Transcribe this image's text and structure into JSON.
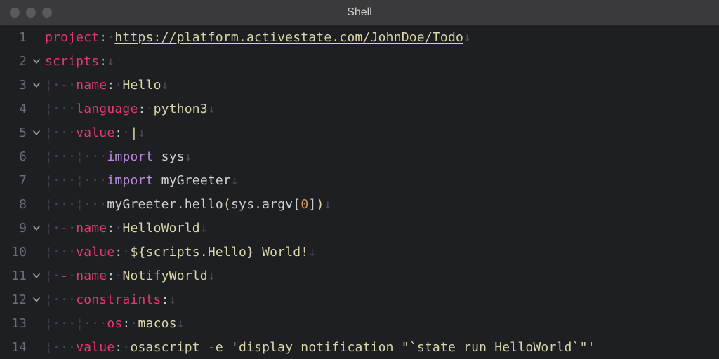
{
  "window": {
    "title": "Shell"
  },
  "glyphs": {
    "dot": "·",
    "nl": "↓",
    "guide": "¦"
  },
  "folds": {
    "2": true,
    "3": true,
    "5": true,
    "9": true,
    "11": true,
    "12": true
  },
  "code": {
    "line1": {
      "key": "project",
      "url": "https://platform.activestate.com/JohnDoe/Todo"
    },
    "line2": {
      "key": "scripts"
    },
    "line3": {
      "key": "name",
      "val": "Hello"
    },
    "line4": {
      "key": "language",
      "val": "python3"
    },
    "line5": {
      "key": "value",
      "pipe": "|"
    },
    "line6": {
      "kw": "import",
      "id": "sys"
    },
    "line7": {
      "kw": "import",
      "id": "myGreeter"
    },
    "line8": {
      "obj": "myGreeter",
      "fn": "hello",
      "arg_obj": "sys",
      "arg_attr": "argv",
      "idx": "0"
    },
    "line9": {
      "key": "name",
      "val": "HelloWorld"
    },
    "line10": {
      "key": "value",
      "val": "${scripts.Hello} World!"
    },
    "line11": {
      "key": "name",
      "val": "NotifyWorld"
    },
    "line12": {
      "key": "constraints"
    },
    "line13": {
      "key": "os",
      "val": "macos"
    },
    "line14": {
      "key": "value",
      "val": "osascript -e 'display notification \"`state run HelloWorld`\"'"
    }
  }
}
